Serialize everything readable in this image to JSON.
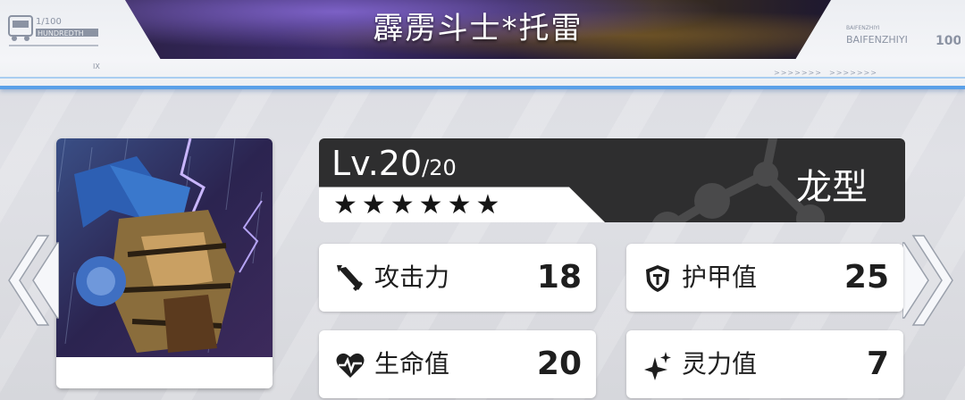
{
  "header": {
    "title": "霹雳斗士*托雷",
    "logo_left": {
      "counter": "1/100",
      "word": "HUNDREDTH"
    },
    "logo_right": {
      "small": "BAIFENZHIYI",
      "word": "BAIFENZHIYI",
      "number": "100"
    },
    "chevrons": ">>>>>>>",
    "mark": "IX"
  },
  "character": {
    "portrait_icon": "dragon-warrior-portrait",
    "level": "Lv.20",
    "level_max": "/20",
    "stars": 6,
    "stars_text": "★★★★★★",
    "type": "龙型"
  },
  "stats": [
    {
      "label": "攻击力",
      "value": "18",
      "icon": "sword-icon"
    },
    {
      "label": "护甲值",
      "value": "25",
      "icon": "shield-icon"
    },
    {
      "label": "生命值",
      "value": "20",
      "icon": "heart-pulse-icon"
    },
    {
      "label": "灵力值",
      "value": "7",
      "icon": "sparkle-icon"
    }
  ],
  "nav": {
    "prev_icon": "chevron-left-icon",
    "next_icon": "chevron-right-icon"
  },
  "colors": {
    "accent": "#5aa0e8",
    "dark_card": "#2e2e2f",
    "text": "#1e1e1e"
  }
}
